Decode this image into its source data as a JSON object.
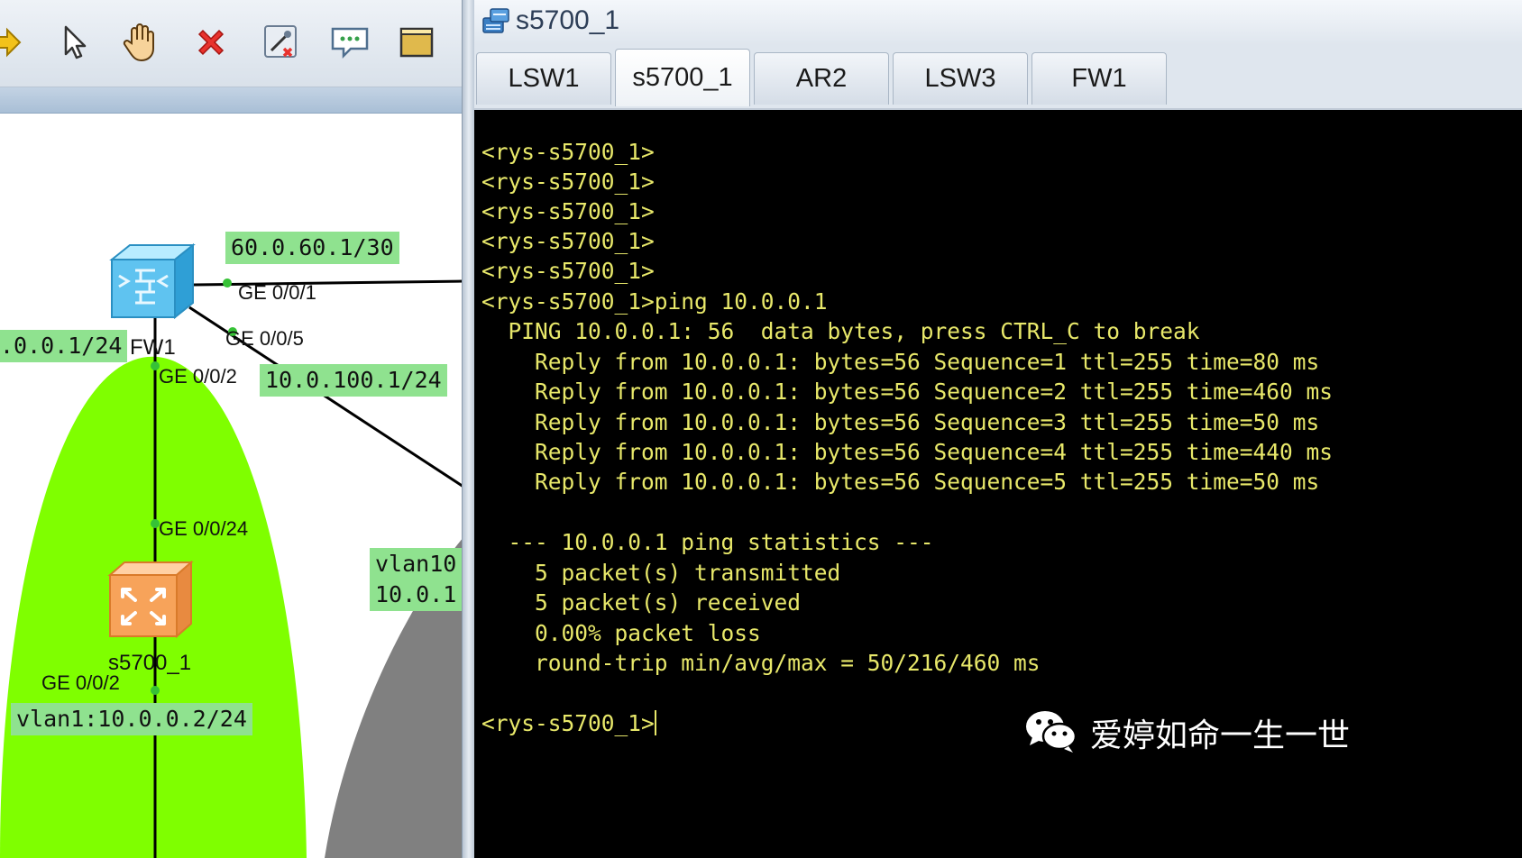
{
  "left": {
    "toolbar": {
      "icons": [
        "arrow-right-icon",
        "pointer-icon",
        "hand-icon",
        "delete-icon",
        "delete-link-icon",
        "text-icon",
        "rectangle-icon"
      ]
    },
    "labels": {
      "ip_fw_top": "60.0.60.1/30",
      "ip_left": ".0.0.1/24",
      "ip_fw_mid": "10.0.100.1/24",
      "vlan_right_1": "vlan10",
      "vlan_right_2": "10.0.1",
      "vlan1": "vlan1:10.0.0.2/24"
    },
    "ports": {
      "fw_g001": "GE 0/0/1",
      "fw_g005": "GE 0/0/5",
      "fw_g002": "GE 0/0/2",
      "sw_g0024": "GE 0/0/24",
      "sw_g002": "GE 0/0/2"
    },
    "devices": {
      "fw_name": "FW1",
      "switch_name": "s5700_1"
    },
    "colors": {
      "zone_green": "#7fff00",
      "zone_gray": "#808080",
      "label_bg": "#8fe28f"
    }
  },
  "console_window": {
    "title": "s5700_1",
    "tabs": [
      "LSW1",
      "s5700_1",
      "AR2",
      "LSW3",
      "FW1"
    ],
    "active_tab": "s5700_1",
    "lines": [
      "<rys-s5700_1>",
      "<rys-s5700_1>",
      "<rys-s5700_1>",
      "<rys-s5700_1>",
      "<rys-s5700_1>",
      "<rys-s5700_1>ping 10.0.0.1",
      "  PING 10.0.0.1: 56  data bytes, press CTRL_C to break",
      "    Reply from 10.0.0.1: bytes=56 Sequence=1 ttl=255 time=80 ms",
      "    Reply from 10.0.0.1: bytes=56 Sequence=2 ttl=255 time=460 ms",
      "    Reply from 10.0.0.1: bytes=56 Sequence=3 ttl=255 time=50 ms",
      "    Reply from 10.0.0.1: bytes=56 Sequence=4 ttl=255 time=440 ms",
      "    Reply from 10.0.0.1: bytes=56 Sequence=5 ttl=255 time=50 ms",
      "",
      "  --- 10.0.0.1 ping statistics ---",
      "    5 packet(s) transmitted",
      "    5 packet(s) received",
      "    0.00% packet loss",
      "    round-trip min/avg/max = 50/216/460 ms",
      "",
      "<rys-s5700_1>"
    ],
    "text_color": "#e8e86a"
  },
  "watermark": {
    "text": "爱婷如命一生一世"
  }
}
